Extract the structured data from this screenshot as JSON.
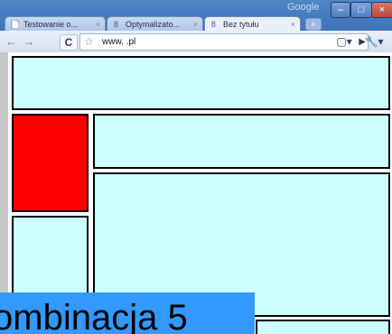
{
  "browser": {
    "brand": "Google",
    "tabs": [
      {
        "label": "Testowanie o...",
        "active": false
      },
      {
        "label": "Optymalizato...",
        "active": false
      },
      {
        "label": "Bez tytułu",
        "active": true
      }
    ],
    "url": "www.          .pl"
  },
  "page": {
    "overlay_text": "ombinacja 5",
    "colors": {
      "panel": "#ccffff",
      "highlight": "#ff0000",
      "overlay": "#3399ff"
    }
  }
}
